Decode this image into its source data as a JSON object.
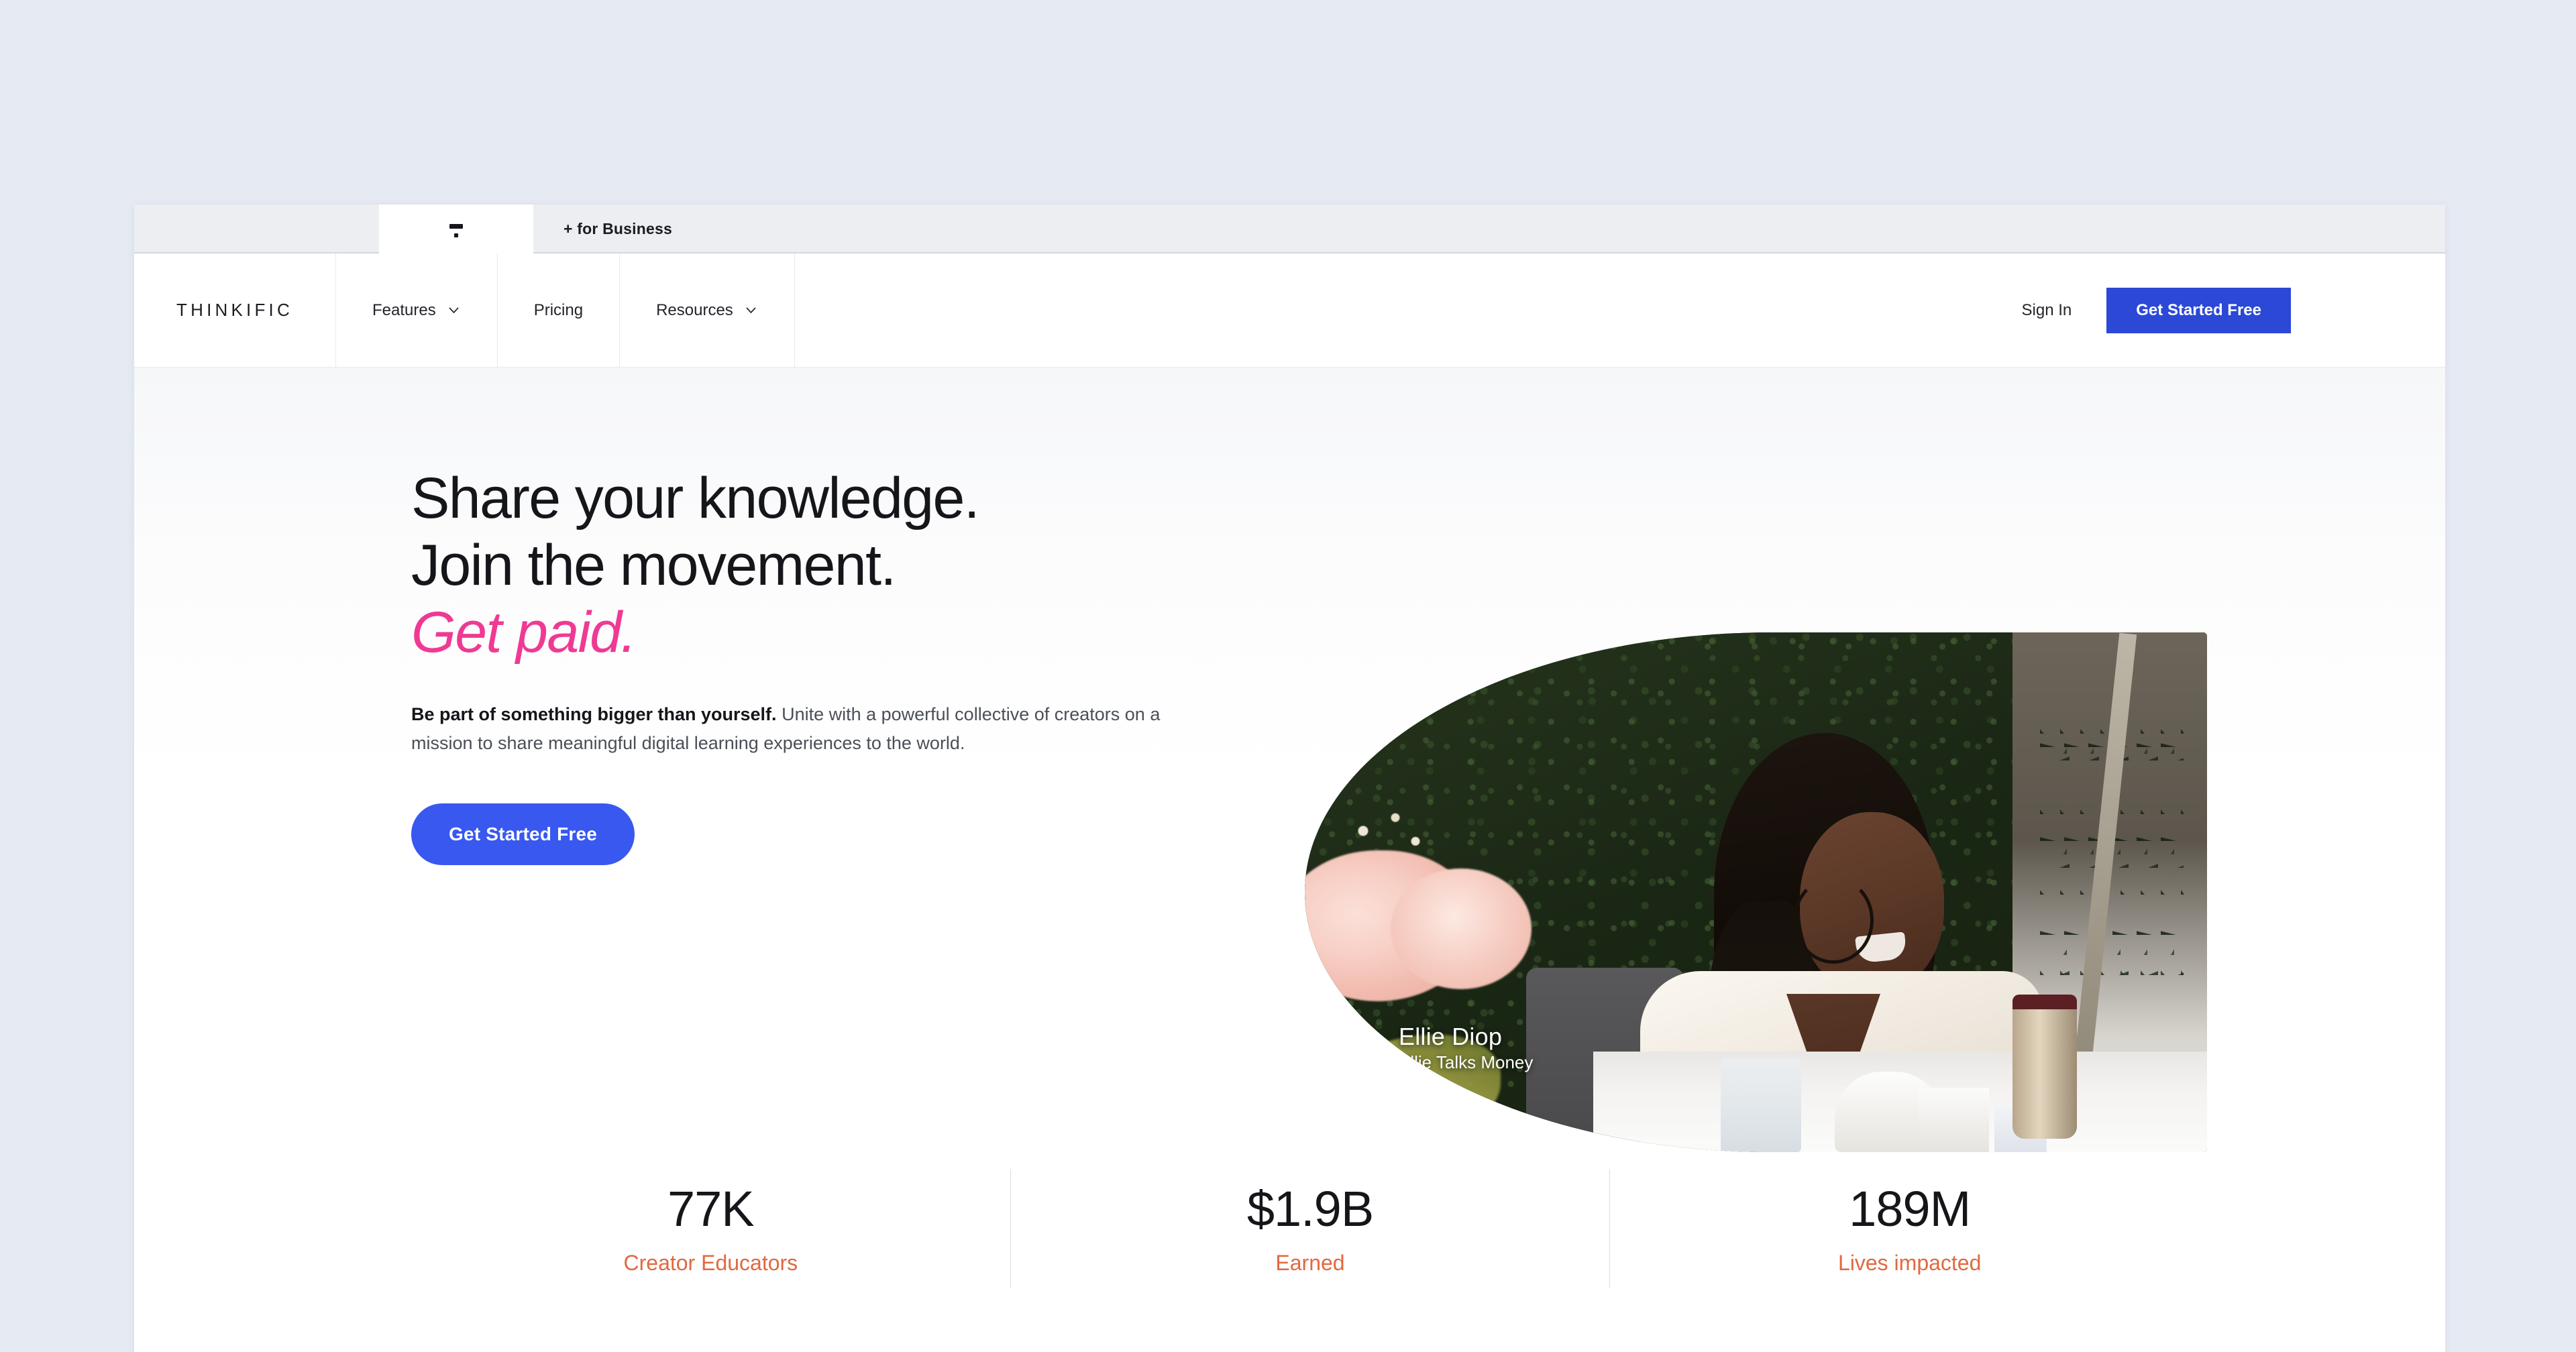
{
  "browser": {
    "active_tab": {
      "favicon": "thinkific-mark-icon",
      "title": ""
    },
    "secondary_tab_label": "+ for Business"
  },
  "nav": {
    "brand": "THINKIFIC",
    "items": [
      {
        "label": "Features",
        "has_dropdown": true,
        "icon": "chevron-down-icon"
      },
      {
        "label": "Pricing",
        "has_dropdown": false
      },
      {
        "label": "Resources",
        "has_dropdown": true,
        "icon": "chevron-down-icon"
      }
    ],
    "signin_label": "Sign In",
    "cta_label": "Get Started Free",
    "cta_color": "#2b48d6"
  },
  "hero": {
    "headline_line1": "Share your knowledge.",
    "headline_line2": "Join the movement.",
    "headline_accent": "Get paid.",
    "accent_color": "#ef3a93",
    "lede_bold": "Be part of something bigger than yourself.",
    "lede_rest": " Unite with a powerful collective of creators on a mission to share meaningful digital learning experiences to the world.",
    "cta_label": "Get Started Free",
    "cta_color": "#3858ef",
    "image_caption_name": "Ellie Diop",
    "image_caption_subtitle": "Ellie Talks Money"
  },
  "stats": {
    "label_color": "#e2683f",
    "items": [
      {
        "value": "77K",
        "label": "Creator Educators"
      },
      {
        "value": "$1.9B",
        "label": "Earned"
      },
      {
        "value": "189M",
        "label": "Lives impacted"
      }
    ]
  }
}
